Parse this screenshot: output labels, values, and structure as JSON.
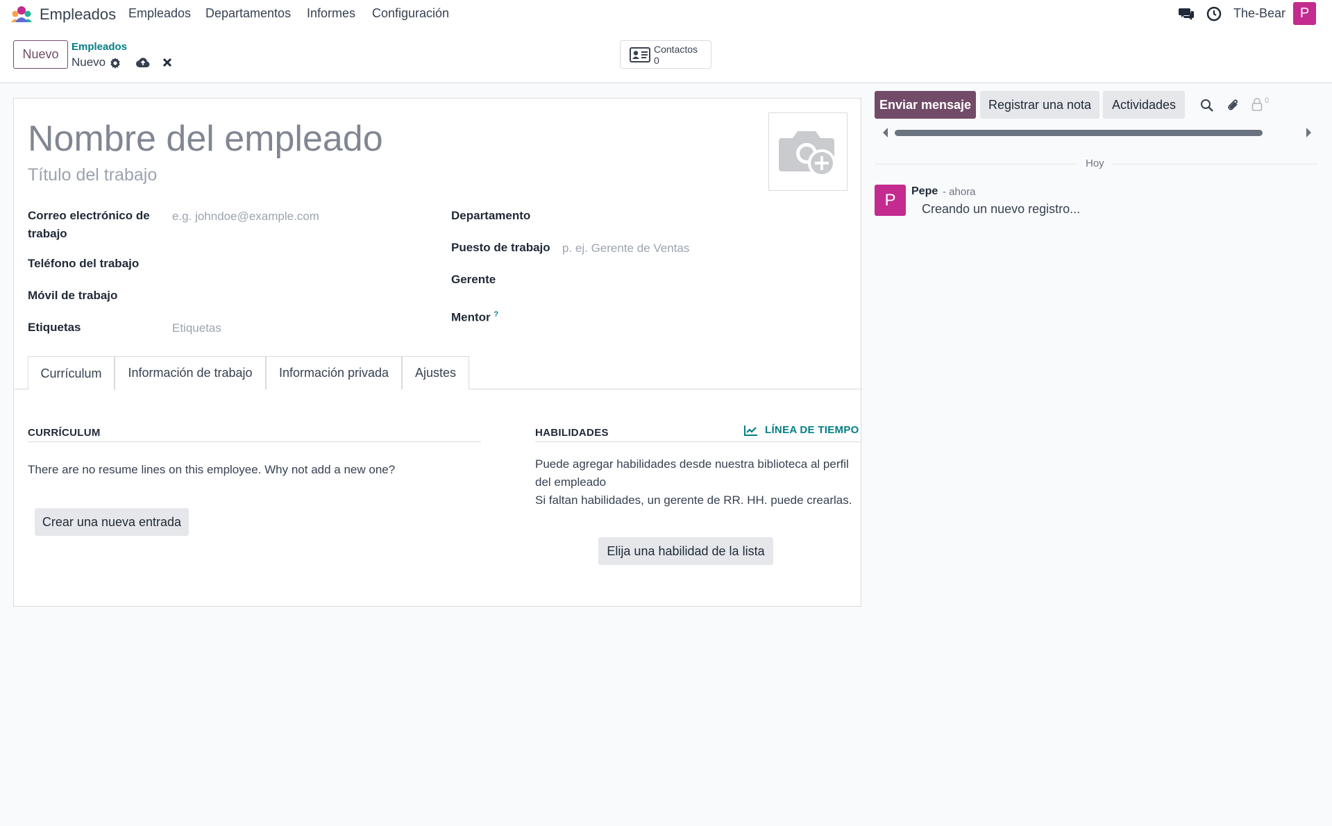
{
  "app": {
    "name": "Empleados"
  },
  "menu": [
    "Empleados",
    "Departamentos",
    "Informes",
    "Configuración"
  ],
  "user": {
    "name": "The-Bear",
    "initial": "P"
  },
  "control": {
    "new_label": "Nuevo",
    "breadcrumb_parent": "Empleados",
    "breadcrumb_current": "Nuevo",
    "smart_button": {
      "label": "Contactos",
      "count": "0"
    }
  },
  "form": {
    "name_placeholder": "Nombre del empleado",
    "job_title_placeholder": "Título del trabajo",
    "left_fields": [
      {
        "label": "Correo electrónico de trabajo",
        "placeholder": "e.g. johndoe@example.com"
      },
      {
        "label": "Teléfono del trabajo",
        "placeholder": ""
      },
      {
        "label": "Móvil de trabajo",
        "placeholder": ""
      },
      {
        "label": "Etiquetas",
        "placeholder": "Etiquetas"
      }
    ],
    "right_fields": [
      {
        "label": "Departamento",
        "placeholder": ""
      },
      {
        "label": "Puesto de trabajo",
        "placeholder": "p. ej. Gerente de Ventas"
      },
      {
        "label": "Gerente",
        "placeholder": ""
      },
      {
        "label": "Mentor",
        "placeholder": "",
        "help": "?"
      }
    ],
    "tabs": [
      "Currículum",
      "Información de trabajo",
      "Información privada",
      "Ajustes"
    ],
    "resume": {
      "title": "CURRÍCULUM",
      "empty_text": "There are no resume lines on this employee. Why not add a new one?",
      "button": "Crear una nueva entrada"
    },
    "skills": {
      "title": "HABILIDADES",
      "timeline_link": "LÍNEA DE TIEMPO",
      "text_line1": "Puede agregar habilidades desde nuestra biblioteca al perfil",
      "text_line2": "del empleado",
      "text_line3": "Si faltan habilidades, un gerente de RR. HH. puede crearlas.",
      "button": "Elija una habilidad de la lista"
    }
  },
  "chatter": {
    "send_message": "Enviar mensaje",
    "log_note": "Registrar una nota",
    "activities": "Actividades",
    "followers_count": "0",
    "day_separator": "Hoy",
    "message": {
      "author": "Pepe",
      "time": "- ahora",
      "body": "Creando un nuevo registro...",
      "avatar_initial": "P"
    }
  },
  "colors": {
    "primary": "#714b67",
    "link": "#017e84",
    "avatar": "#c32b8e"
  }
}
